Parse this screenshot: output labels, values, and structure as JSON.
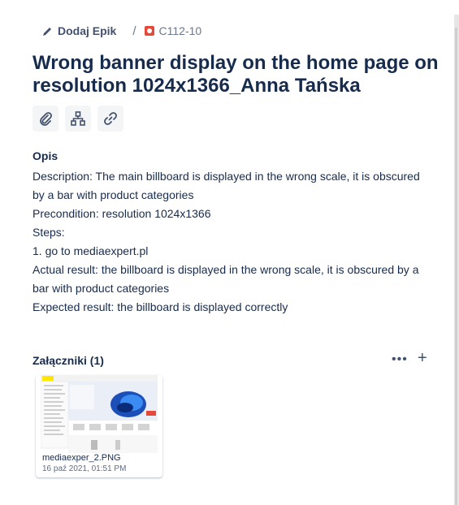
{
  "breadcrumb": {
    "epic_label": "Dodaj Epik",
    "separator": "/",
    "issue_key": "C112-10"
  },
  "issue": {
    "title": "Wrong banner display on the home page on resolution 1024x1366_Anna Tańska"
  },
  "description": {
    "heading": "Opis",
    "lines": [
      "Description: The main billboard is displayed in the wrong scale, it is obscured by a bar with product categories",
      "Precondition: resolution 1024x1366",
      "Steps:",
      "1. go to mediaexpert.pl",
      "Actual result: the billboard is displayed in the wrong scale, it is obscured by a bar with product categories",
      "Expected result:  the billboard is displayed correctly"
    ]
  },
  "attachments": {
    "heading": "Załączniki (1)",
    "more": "•••",
    "add": "+",
    "items": [
      {
        "name": "mediaexper_2.PNG",
        "date": "16 paź 2021, 01:51 PM"
      }
    ]
  },
  "colors": {
    "accent": "#e5493a",
    "text": "#172b4d",
    "button_bg": "#f4f5f7"
  }
}
